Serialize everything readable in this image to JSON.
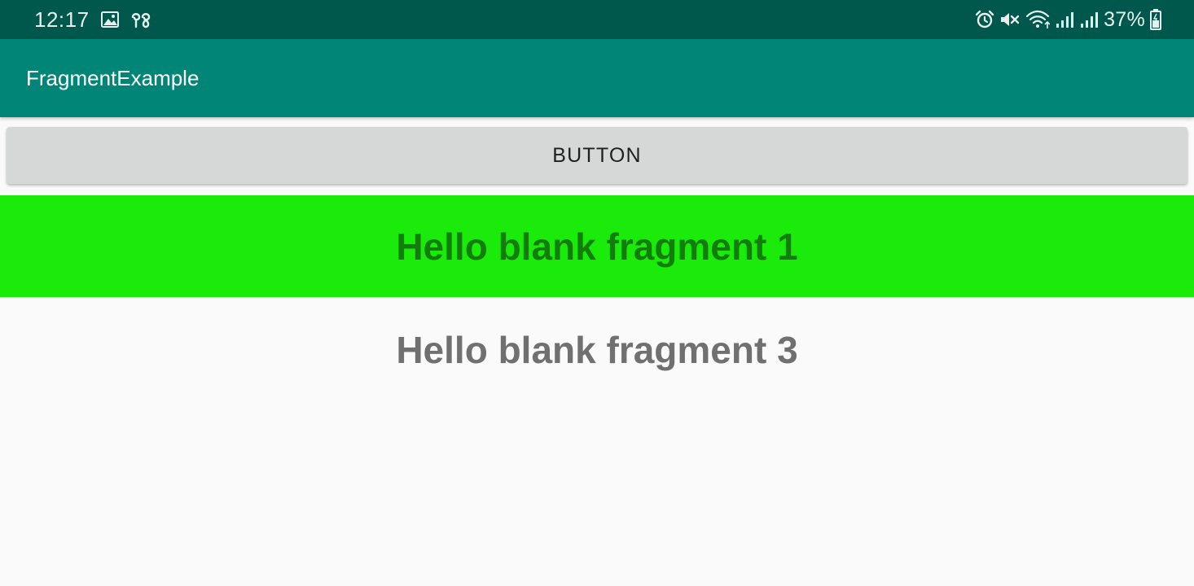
{
  "status_bar": {
    "time": "12:17",
    "extra_text": "৪৪",
    "battery_percent": "37%",
    "icons": [
      "image-icon",
      "alarm-icon",
      "mute-icon",
      "wifi-icon",
      "signal-icon",
      "signal-icon",
      "battery-icon"
    ],
    "background_color": "#00574b"
  },
  "app_bar": {
    "title": "FragmentExample",
    "background_color": "#008577"
  },
  "button": {
    "label": "BUTTON"
  },
  "fragment_1": {
    "text": "Hello blank fragment 1",
    "background_color": "#1aeb0b",
    "text_color": "#137d0c"
  },
  "fragment_3": {
    "text": "Hello blank fragment 3",
    "text_color": "#707070"
  }
}
